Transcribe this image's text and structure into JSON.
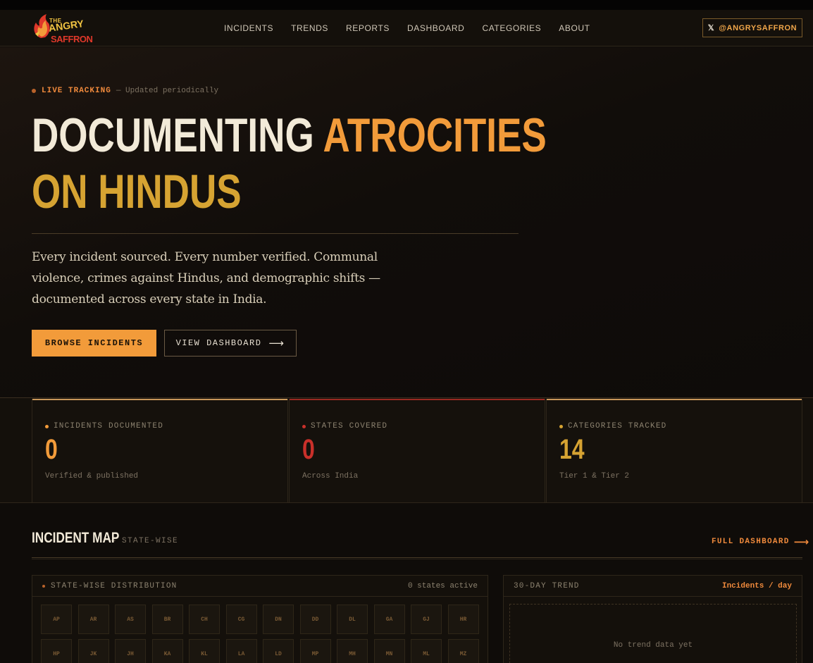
{
  "header": {
    "logo": {
      "line1": "THE",
      "line2": "ANGRY",
      "line3": "SAFFRON"
    },
    "nav": [
      "INCIDENTS",
      "TRENDS",
      "REPORTS",
      "DASHBOARD",
      "CATEGORIES",
      "ABOUT"
    ],
    "social": {
      "icon": "x-icon",
      "glyph": "𝕏",
      "label": "@ANGRYSAFFRON"
    }
  },
  "hero": {
    "badge": {
      "label": "LIVE TRACKING",
      "note": "— Updated periodically"
    },
    "title": {
      "part1": "DOCUMENTING",
      "part2": "ATROCITIES",
      "part3": "ON HINDUS"
    },
    "lead": "Every incident sourced. Every number verified. Communal violence, crimes against Hindus, and demographic shifts — documented across every state in India.",
    "primary_cta": "BROWSE INCIDENTS",
    "secondary_cta": "VIEW DASHBOARD",
    "arrow": "⟶"
  },
  "stats": [
    {
      "label": "INCIDENTS DOCUMENTED",
      "value": "0",
      "sub": "Verified & published",
      "color": "#f29b3a",
      "bar": "#c9975a"
    },
    {
      "label": "STATES COVERED",
      "value": "0",
      "sub": "Across India",
      "color": "#c9302a",
      "bar": "#9a2a22"
    },
    {
      "label": "CATEGORIES TRACKED",
      "value": "14",
      "sub": "Tier 1 & Tier 2",
      "color": "#d6a332",
      "bar": "#c9975a"
    }
  ],
  "map": {
    "title": "INCIDENT MAP",
    "subtitle": "— STATE-WISE",
    "full_link": "FULL DASHBOARD",
    "distribution": {
      "title": "STATE-WISE DISTRIBUTION",
      "status": "0 states active",
      "states": [
        "AP",
        "AR",
        "AS",
        "BR",
        "CH",
        "CG",
        "DN",
        "DD",
        "DL",
        "GA",
        "GJ",
        "HR",
        "HP",
        "JK",
        "JH",
        "KA",
        "KL",
        "LA",
        "LD",
        "MP",
        "MH",
        "MN",
        "ML",
        "MZ"
      ]
    },
    "trend": {
      "title": "30-DAY TREND",
      "unit": "Incidents / day",
      "empty": "No trend data yet"
    }
  },
  "colors": {
    "accent": "#f29b3a",
    "gold": "#d6a332",
    "red": "#c9302a",
    "bg": "#0f0c09"
  }
}
